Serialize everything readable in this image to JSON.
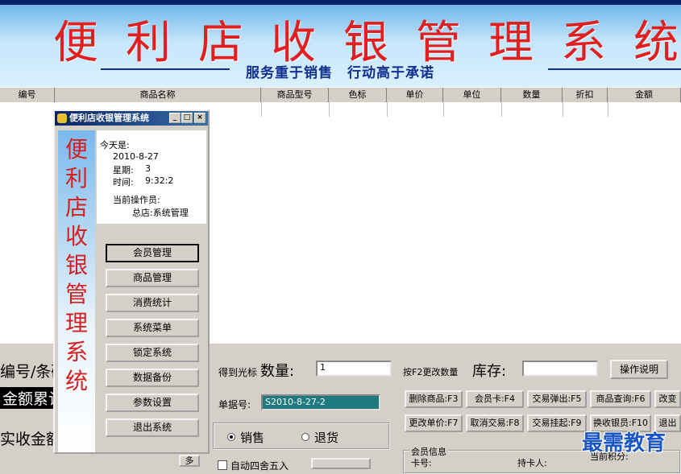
{
  "banner": {
    "title": "便利店收银管理系统",
    "slogan": "服务重于销售　行动高于承诺"
  },
  "table": {
    "columns": [
      "编号",
      "商品名称",
      "商品型号",
      "色标",
      "单价",
      "单位",
      "数量",
      "折扣",
      "金额"
    ]
  },
  "bottom": {
    "code_label": "编号/条码",
    "barcode_label": "得到光标",
    "qty_label": "数量:",
    "qty_value": "1",
    "f2_hint": "按F2更改数量",
    "stock_label": "库存:",
    "stock_value": "",
    "help_button": "操作说明",
    "cumulative_label": "金额累计",
    "receipt_label": "单据号:",
    "receipt_value": "S2010-8-27-2",
    "actual_label": "实收金额",
    "sale_label": "销售",
    "return_label": "退货",
    "auto_label": "自动四舍五入",
    "more_button": "多",
    "buttons": [
      "删除商品:F3",
      "会员卡:F4",
      "交易弹出:F5",
      "商品查询:F6",
      "改变",
      "更改单价:F7",
      "取消交易:F8",
      "交易挂起:F9",
      "换收银员:F10",
      "退出"
    ],
    "member_group_title": "会员信息",
    "member_card_label": "卡号:",
    "member_holder_label": "持卡人:",
    "current_points_label": "当前积分:"
  },
  "dialog": {
    "title": "便利店收银管理系统",
    "vertical_title": [
      "便",
      "利",
      "店",
      "收",
      "银",
      "管",
      "理",
      "系",
      "统"
    ],
    "today_label": "今天是:",
    "date": "2010-8-27",
    "weekday_label": "星期:",
    "weekday": "3",
    "time_label": "时间:",
    "time": "9:32:2",
    "operator_label": "当前操作员:",
    "operator": "总店:系统管理",
    "menu": [
      "会员管理",
      "商品管理",
      "消费统计",
      "系统菜单",
      "锁定系统",
      "数据备份",
      "参数设置",
      "退出系统"
    ]
  },
  "watermark": "最需教育"
}
